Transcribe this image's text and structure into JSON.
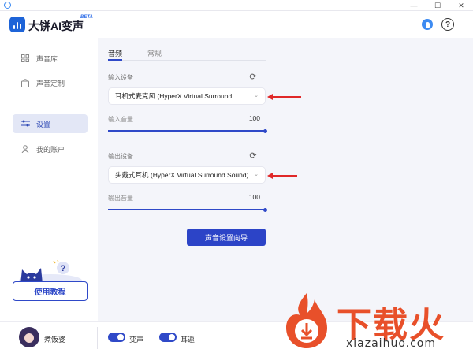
{
  "header": {
    "app_title": "大饼AI变声",
    "beta": "BETA",
    "help_glyph": "?"
  },
  "window_controls": {
    "minimize": "—",
    "maximize": "☐",
    "close": "✕"
  },
  "sidebar": {
    "items": [
      {
        "label": "声音库",
        "icon": "grid-icon",
        "active": false
      },
      {
        "label": "声音定制",
        "icon": "bag-icon",
        "active": false
      },
      {
        "label": "设置",
        "icon": "sliders-icon",
        "active": true
      },
      {
        "label": "我的账户",
        "icon": "user-icon",
        "active": false
      }
    ],
    "tutorial_button": "使用教程",
    "mascot_bubble": "?"
  },
  "tabs": [
    {
      "label": "音频",
      "active": true
    },
    {
      "label": "常规",
      "active": false
    }
  ],
  "input": {
    "device_label": "输入设备",
    "device_value": "耳机式麦克风 (HyperX Virtual Surround",
    "volume_label": "输入音量",
    "volume_value": "100"
  },
  "output": {
    "device_label": "输出设备",
    "device_value": "头戴式耳机 (HyperX Virtual Surround Sound)",
    "volume_label": "输出音量",
    "volume_value": "100"
  },
  "wizard_button": "声音设置向导",
  "bottom_bar": {
    "username": "煮饭婆",
    "toggles": [
      {
        "label": "变声",
        "on": true
      },
      {
        "label": "耳返",
        "on": true
      }
    ]
  },
  "watermark": {
    "text": "下载火",
    "url": "xiazaihuo.com"
  },
  "colors": {
    "accent": "#2f49c8",
    "arrow": "#e02828",
    "watermark": "#e8502a"
  }
}
